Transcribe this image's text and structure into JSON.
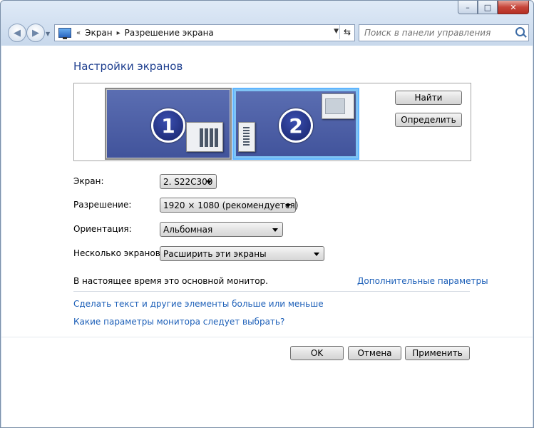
{
  "window": {
    "caption_buttons": {
      "minimize": "–",
      "maximize": "□",
      "close": "✕"
    }
  },
  "nav": {
    "back_icon": "arrow-left-icon",
    "forward_icon": "arrow-right-icon",
    "breadcrumb": {
      "overflow": "«",
      "item1": "Экран",
      "separator": "▸",
      "item2": "Разрешение экрана"
    },
    "refresh_icon": "refresh-icon",
    "search_placeholder": "Поиск в панели управления"
  },
  "page": {
    "title": "Настройки экранов",
    "monitors": [
      {
        "number": "1",
        "selected": false
      },
      {
        "number": "2",
        "selected": true
      }
    ],
    "find_button": "Найти",
    "identify_button": "Определить",
    "fields": {
      "display_label": "Экран:",
      "display_value": "2. S22C300",
      "resolution_label": "Разрешение:",
      "resolution_value": "1920 × 1080 (рекомендуется)",
      "orientation_label": "Ориентация:",
      "orientation_value": "Альбомная",
      "multiple_label": "Несколько экранов:",
      "multiple_value": "Расширить эти экраны"
    },
    "main_monitor_text": "В настоящее время это основной монитор.",
    "advanced_link": "Дополнительные параметры",
    "link_text_size": "Сделать текст и другие элементы больше или меньше",
    "link_which_settings": "Какие параметры монитора следует выбрать?"
  },
  "footer": {
    "ok": "OK",
    "cancel": "Отмена",
    "apply": "Применить"
  },
  "colors": {
    "link": "#1c5fb8",
    "heading": "#1e3f8f",
    "monitor_fill": "#4b5da6",
    "selected_border": "#5fb5ff"
  }
}
